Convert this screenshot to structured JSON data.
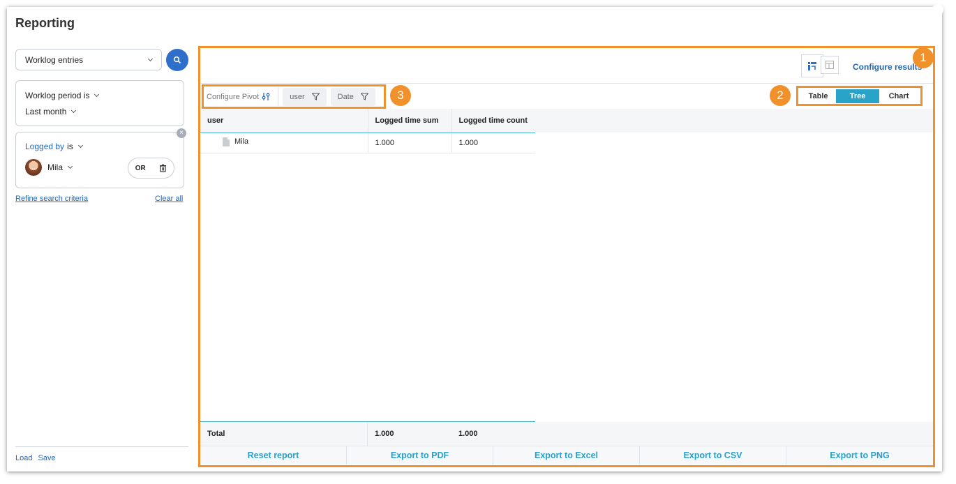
{
  "page_title": "Reporting",
  "left_panel": {
    "entity_select": "Worklog entries",
    "criteria": [
      {
        "label": "Worklog period is",
        "value": "Last month"
      },
      {
        "label_link": "Logged by",
        "label_rest": "is",
        "user": "Mila",
        "operator": "OR"
      }
    ],
    "refine_link": "Refine search criteria",
    "clear_link": "Clear all",
    "load_link": "Load",
    "save_link": "Save"
  },
  "toolbar": {
    "configure_results": "Configure results",
    "configure_pivot": "Configure Pivot",
    "chip_user": "user",
    "chip_date": "Date",
    "view_modes": [
      "Table",
      "Tree",
      "Chart"
    ],
    "active_mode": "Tree"
  },
  "annotations": [
    "1",
    "2",
    "3"
  ],
  "table": {
    "columns": [
      "user",
      "Logged time sum",
      "Logged time count"
    ],
    "rows": [
      {
        "user": "Mila",
        "sum": "1.000",
        "count": "1.000"
      }
    ],
    "total": {
      "label": "Total",
      "sum": "1.000",
      "count": "1.000"
    }
  },
  "exports": [
    "Reset report",
    "Export to PDF",
    "Export to Excel",
    "Export to CSV",
    "Export to PNG"
  ],
  "colors": {
    "accent": "#2f6fc9",
    "annotation": "#f0912c",
    "active_tab": "#2aa3c9",
    "export_text": "#2a9fc7"
  }
}
